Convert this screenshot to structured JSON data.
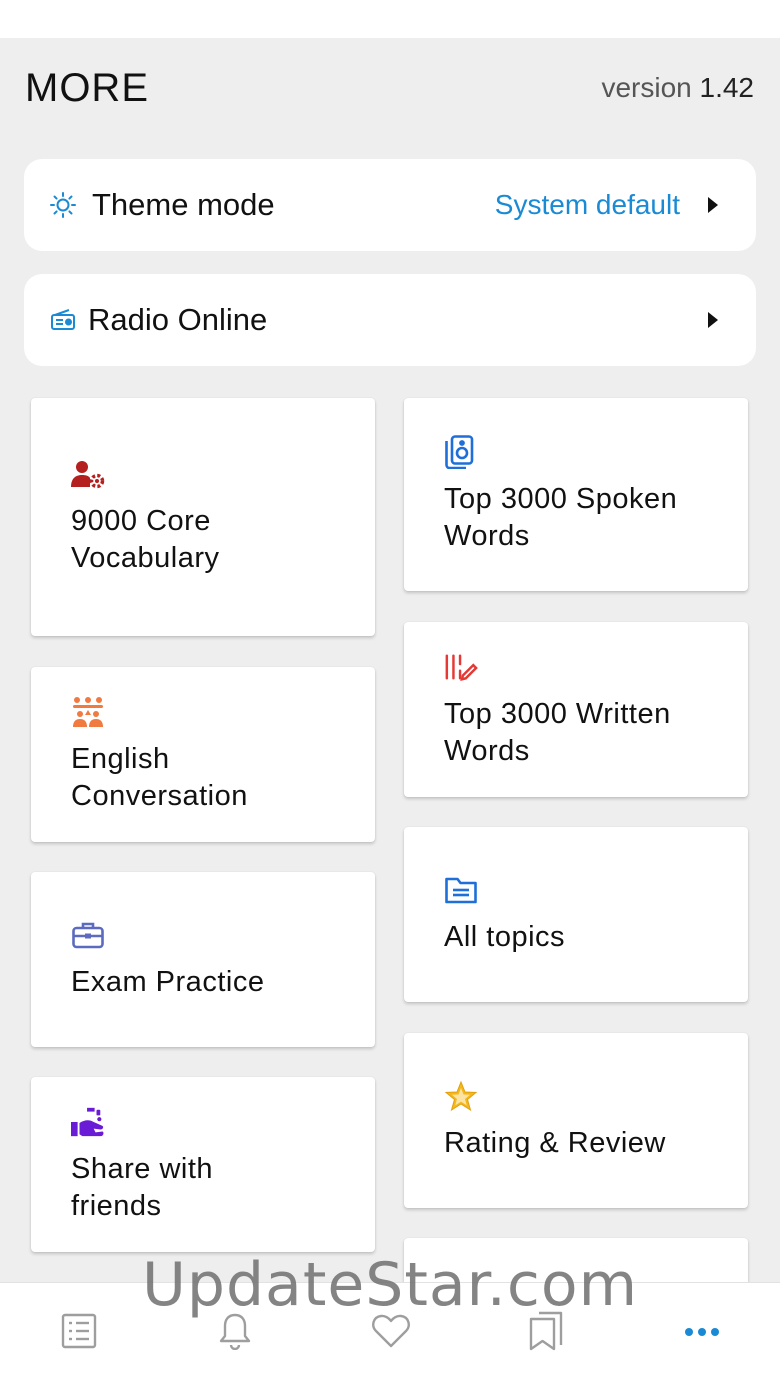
{
  "header": {
    "title": "MORE",
    "version_prefix": "version ",
    "version_number": "1.42"
  },
  "settings": {
    "theme": {
      "label": "Theme mode",
      "value": "System default",
      "icon": "sun-icon"
    },
    "radio": {
      "label": "Radio Online",
      "icon": "radio-icon"
    }
  },
  "tiles": {
    "left": [
      {
        "label": "9000 Core\nVocabulary",
        "icon": "user-gear-icon",
        "color": "#b41f1f"
      },
      {
        "label": "English\nConversation",
        "icon": "group-icon",
        "color": "#f07a40"
      },
      {
        "label": "Exam Practice",
        "icon": "briefcase-icon",
        "color": "#5c6bc0"
      },
      {
        "label": "Share with\nfriends",
        "icon": "share-hand-icon",
        "color": "#6a1bd6"
      }
    ],
    "right": [
      {
        "label": "Top 3000 Spoken\nWords",
        "icon": "speaker-icon",
        "color": "#1e6fd9"
      },
      {
        "label": "Top 3000 Written\nWords",
        "icon": "pencil-book-icon",
        "color": "#e53935"
      },
      {
        "label": "All topics",
        "icon": "folder-icon",
        "color": "#1e6fd9"
      },
      {
        "label": "Rating & Review",
        "icon": "star-icon",
        "color": "#f5b81c"
      }
    ]
  },
  "tabbar": {
    "tabs": [
      "list-icon",
      "bell-icon",
      "heart-icon",
      "bookmarks-icon",
      "more-icon"
    ],
    "active_color": "#1a8ad4",
    "inactive_color": "#9e9e9e"
  },
  "watermark": "UpdateStar.com"
}
